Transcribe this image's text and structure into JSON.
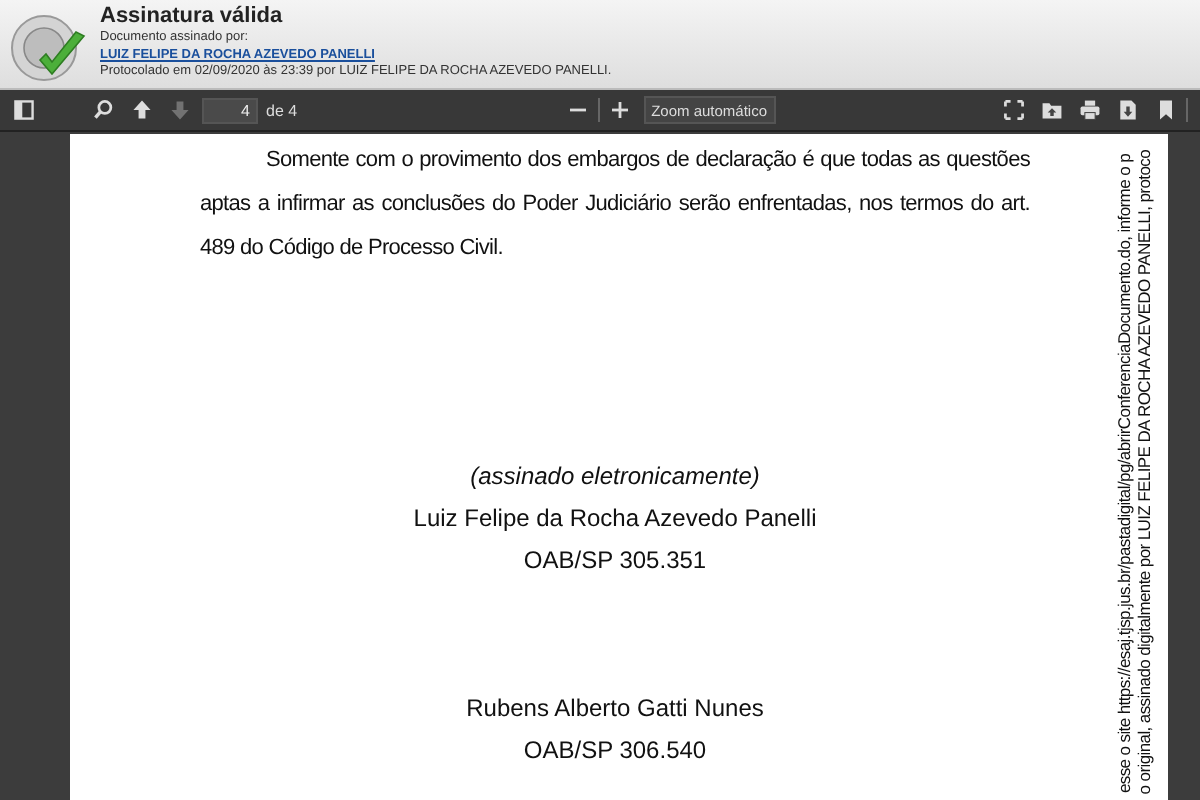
{
  "signature_banner": {
    "title": "Assinatura válida",
    "label": "Documento assinado por:",
    "signer": "LUIZ FELIPE DA ROCHA AZEVEDO PANELLI",
    "protocol": "Protocolado em 02/09/2020 às 23:39 por LUIZ FELIPE DA ROCHA AZEVEDO PANELLI."
  },
  "toolbar": {
    "left_buttons": [
      {
        "kind": "sidebar",
        "disabled": false
      },
      {
        "kind": "search",
        "disabled": false
      },
      {
        "kind": "up",
        "disabled": false
      },
      {
        "kind": "down",
        "disabled": true
      }
    ],
    "page_number": "4",
    "page_count": "de 4",
    "zoom": "Zoom automático",
    "right_buttons": [
      {
        "kind": "fullscreen",
        "disabled": false
      },
      {
        "kind": "open",
        "disabled": false
      },
      {
        "kind": "print",
        "disabled": false
      },
      {
        "kind": "download",
        "disabled": false
      },
      {
        "kind": "bookmark",
        "disabled": false
      }
    ]
  },
  "document": {
    "paragraph": "Somente com o provimento dos embargos de declaração é que todas as questões aptas a infirmar as conclusões do Poder Judiciário serão enfrentadas, nos termos do art. 489 do Código de Processo Civil.",
    "signatures": [
      {
        "lines": [
          {
            "text": "(assinado eletronicamente)",
            "italic": true
          },
          {
            "text": "Luiz Felipe da Rocha Azevedo Panelli",
            "italic": false
          },
          {
            "text": "OAB/SP 305.351",
            "italic": false
          }
        ]
      },
      {
        "lines": [
          {
            "text": "Rubens Alberto Gatti Nunes",
            "italic": false
          },
          {
            "text": "OAB/SP 306.540",
            "italic": false
          }
        ]
      }
    ],
    "margin_notes": [
      "o original, assinado digitalmente por LUIZ FELIPE DA ROCHA AZEVEDO PANELLI, protoco",
      "esse o site https://esaj.tjsp.jus.br/pastadigital/pg/abrirConferenciaDocumento.do, informe o p"
    ]
  }
}
